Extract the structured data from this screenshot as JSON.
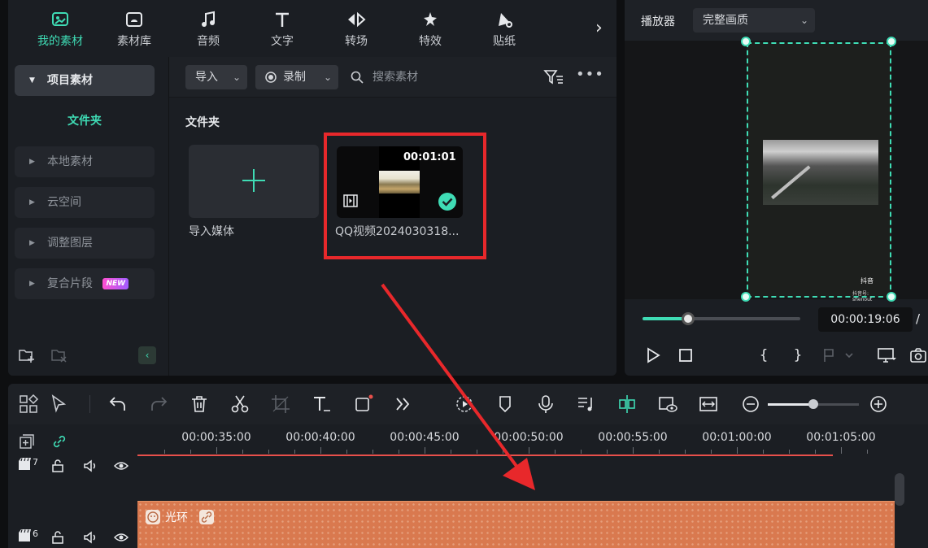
{
  "tabs": [
    {
      "label": "我的素材",
      "icon": "my-media-icon",
      "active": true
    },
    {
      "label": "素材库",
      "icon": "stock-library-icon"
    },
    {
      "label": "音频",
      "icon": "music-note-icon"
    },
    {
      "label": "文字",
      "icon": "text-icon"
    },
    {
      "label": "转场",
      "icon": "transition-icon"
    },
    {
      "label": "特效",
      "icon": "effects-icon"
    },
    {
      "label": "贴纸",
      "icon": "sticker-icon"
    }
  ],
  "tabs_more": "›",
  "sidebar": {
    "project_media": "项目素材",
    "folder": "文件夹",
    "local_media": "本地素材",
    "cloud_space": "云空间",
    "adjustment_layer": "调整图层",
    "compound_clip": "复合片段",
    "new_badge": "NEW",
    "collapse": "‹"
  },
  "toolbar": {
    "import_label": "导入",
    "record_label": "录制",
    "search_placeholder": "搜索素材",
    "more": "•••"
  },
  "content": {
    "folder_heading": "文件夹",
    "import_media_label": "导入媒体",
    "video": {
      "duration": "00:01:01",
      "name": "QQ视频2024030318..."
    }
  },
  "player": {
    "title": "播放器",
    "quality": "完整画质",
    "current_time": "00:00:19:06",
    "time_separator": "/",
    "progress_fraction": 0.29,
    "douyin_logo": "抖音",
    "douyin_id": "抖音号: shenout",
    "mark_in": "{",
    "mark_out": "}"
  },
  "timeline": {
    "ticks": [
      "00:00:35:00",
      "00:00:40:00",
      "00:00:45:00",
      "00:00:50:00",
      "00:00:55:00",
      "00:01:00:00",
      "00:01:05:00"
    ],
    "zoom_fraction": 0.5,
    "tracks": [
      {
        "number": "7"
      },
      {
        "number": "6"
      }
    ],
    "effect_clip": {
      "name": "光环"
    }
  },
  "colors": {
    "accent": "#3fdcb5",
    "highlight": "#e8282b",
    "clip": "#d9794f"
  }
}
